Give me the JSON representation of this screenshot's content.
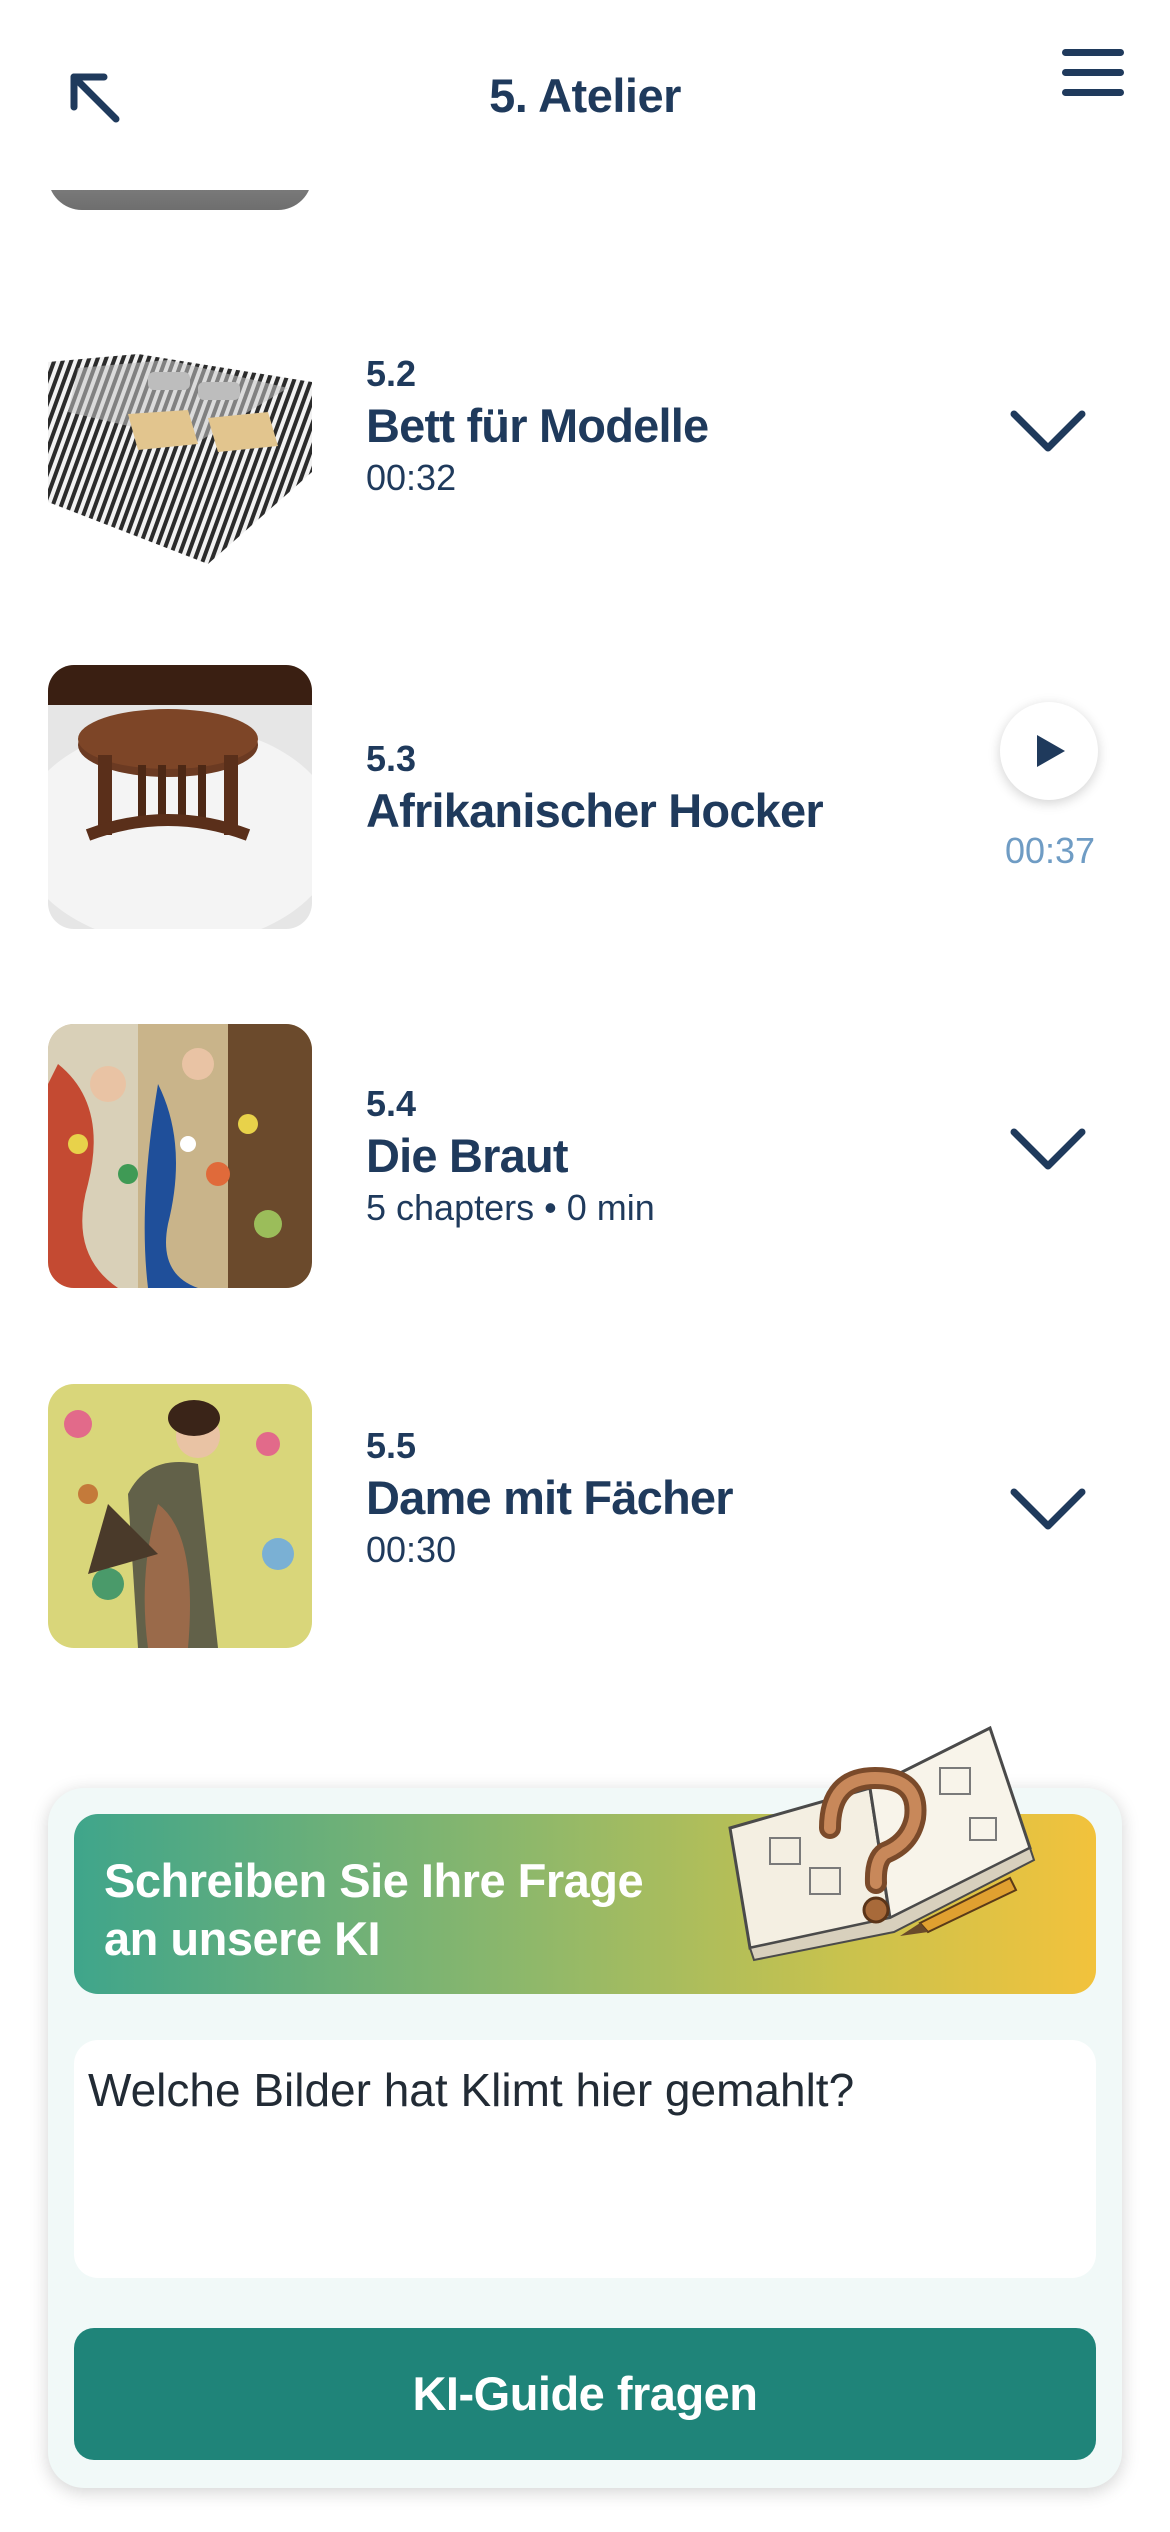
{
  "header": {
    "title": "5. Atelier",
    "back_icon": "arrow-up-left-icon",
    "menu_icon": "hamburger-menu-icon"
  },
  "items": [
    {
      "number": "5.2",
      "title": "Bett für Modelle",
      "subtitle": "00:32",
      "action": "chevron-down-icon"
    },
    {
      "number": "5.3",
      "title": "Afrikanischer Hocker",
      "subtitle": "",
      "action": "play-icon",
      "duration": "00:37"
    },
    {
      "number": "5.4",
      "title": "Die Braut",
      "subtitle": "5 chapters • 0 min",
      "action": "chevron-down-icon"
    },
    {
      "number": "5.5",
      "title": "Dame mit Fächer",
      "subtitle": "00:30",
      "action": "chevron-down-icon"
    }
  ],
  "ai": {
    "banner_text_line1": "Schreiben Sie Ihre Frage",
    "banner_text_line2": "an unsere KI",
    "input_value": "Welche Bilder hat Klimt hier gemahlt?",
    "button_label": "KI-Guide fragen"
  },
  "colors": {
    "primary_text": "#1f3a5c",
    "accent_teal": "#1f8479",
    "time_blue": "#6f9cc4"
  }
}
